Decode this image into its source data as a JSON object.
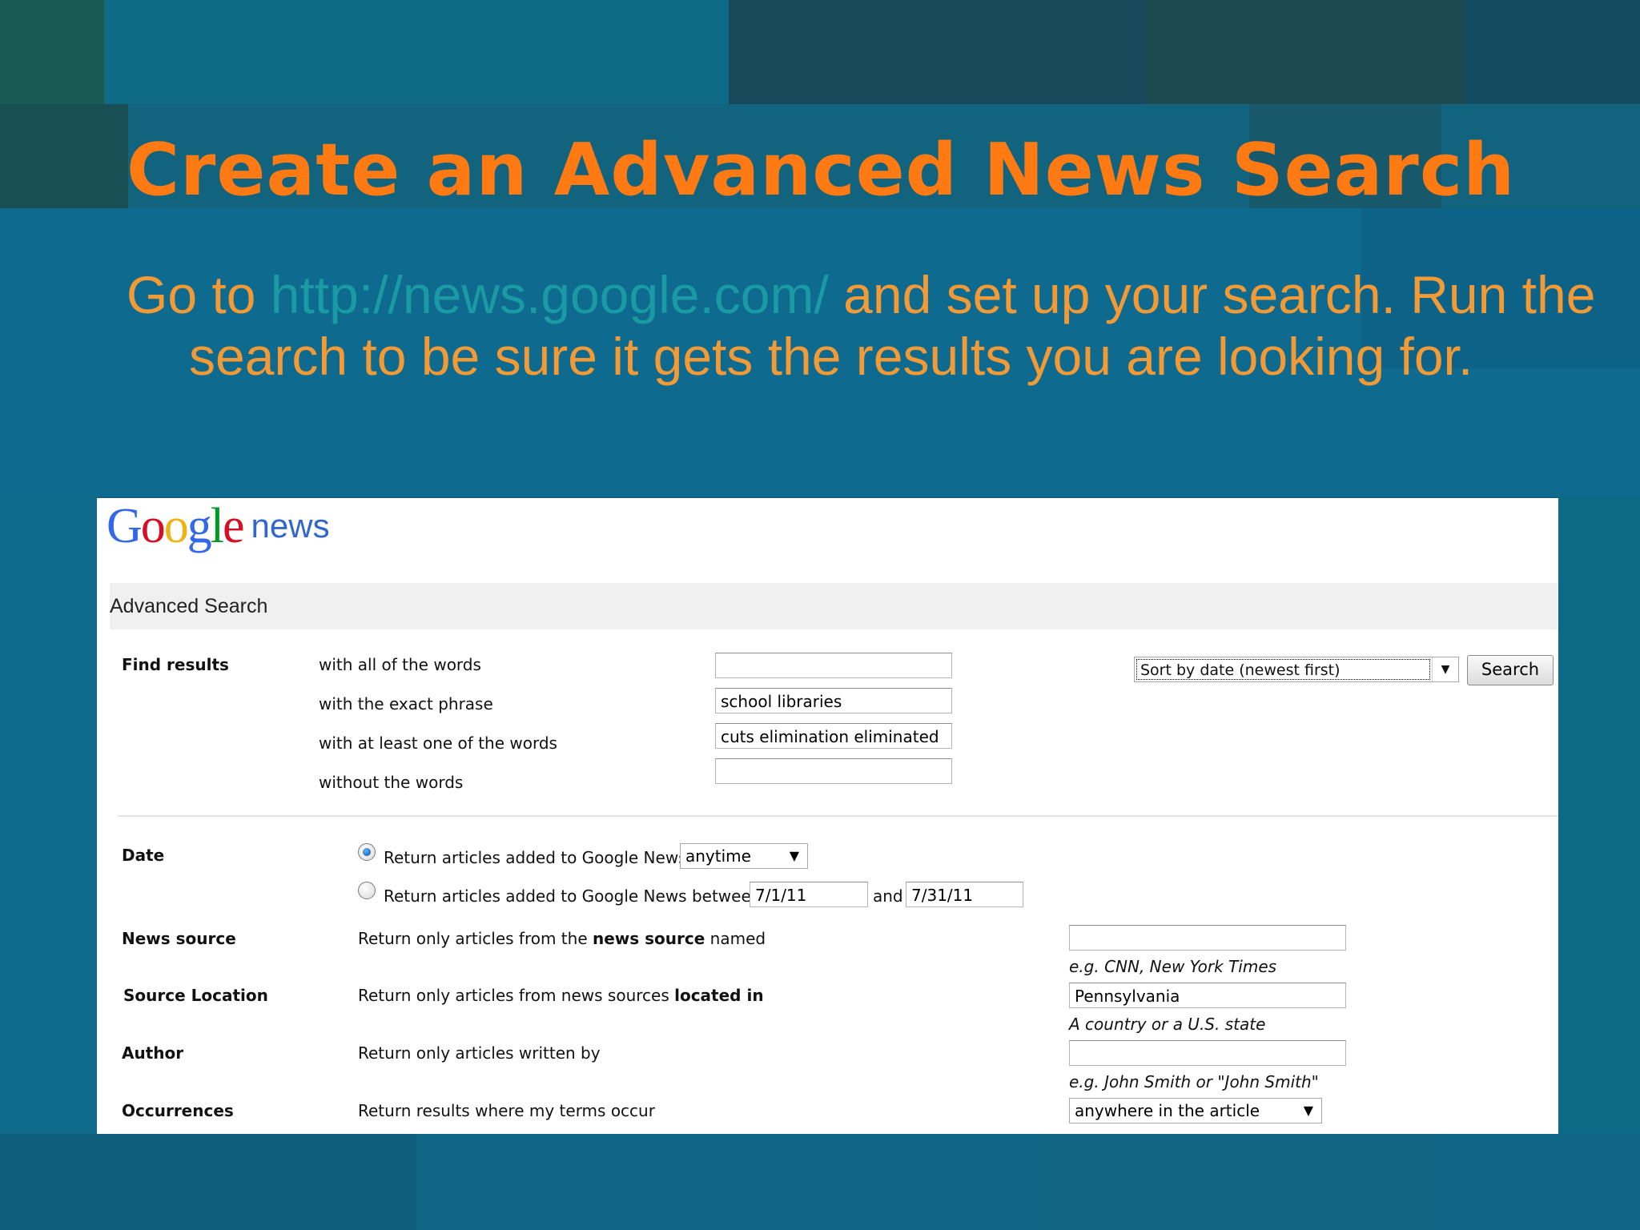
{
  "slide": {
    "title": "Create an Advanced News Search",
    "body_prefix": "Go to ",
    "body_link": "http://news.google.com/",
    "body_suffix": " and set up your search. Run the search to be sure it gets the results you are looking for."
  },
  "logo": {
    "letters": [
      "G",
      "o",
      "o",
      "g",
      "l",
      "e"
    ],
    "letter_colors": [
      "#3369e8",
      "#d50f25",
      "#eeb211",
      "#3369e8",
      "#009925",
      "#d50f25"
    ],
    "product": "news"
  },
  "page_title": "Advanced Search",
  "find_results": {
    "label": "Find results",
    "rows": [
      {
        "text": "with all of the words",
        "value": ""
      },
      {
        "text": "with the exact phrase",
        "value": "school libraries"
      },
      {
        "text": "with at least one of the words",
        "value": "cuts elimination eliminated"
      },
      {
        "text": "without the words",
        "value": ""
      }
    ]
  },
  "sort": {
    "selected": "Sort by date (newest first)"
  },
  "search_button": "Search",
  "date": {
    "label": "Date",
    "option_anytime": "Return articles added to Google News",
    "anytime_value": "anytime",
    "option_between": "Return articles added to Google News between",
    "from": "7/1/11",
    "and_label": "and",
    "to": "7/31/11"
  },
  "news_source": {
    "label": "News source",
    "text_before": "Return only articles from the ",
    "text_bold": "news source",
    "text_after": " named",
    "value": "",
    "hint": "e.g. CNN, New York Times"
  },
  "source_location": {
    "label": "Source Location",
    "text_before": "Return only articles from news sources ",
    "text_bold": "located in",
    "value": "Pennsylvania",
    "hint": "A country or a U.S. state"
  },
  "author": {
    "label": "Author",
    "text": "Return only articles written by",
    "value": "",
    "hint": "e.g. John Smith or \"John Smith\""
  },
  "occurrences": {
    "label": "Occurrences",
    "text": "Return results where my terms occur",
    "selected": "anywhere in the article"
  }
}
